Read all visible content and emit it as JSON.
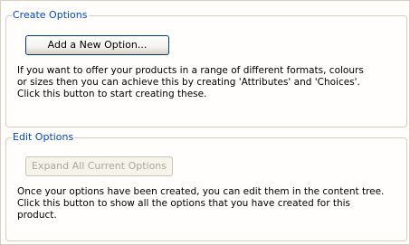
{
  "create_options": {
    "legend": "Create Options",
    "button_label": "Add a New Option...",
    "description": "If you want to offer your products in a range of different formats, colours\nor sizes then you can achieve this by creating 'Attributes' and 'Choices'.\nClick this button to start creating these."
  },
  "edit_options": {
    "legend": "Edit Options",
    "button_label": "Expand All Current Options",
    "description": "Once your options have been created, you can edit them in the content tree.\nClick this button to show all the options that you have created for this\nproduct."
  }
}
